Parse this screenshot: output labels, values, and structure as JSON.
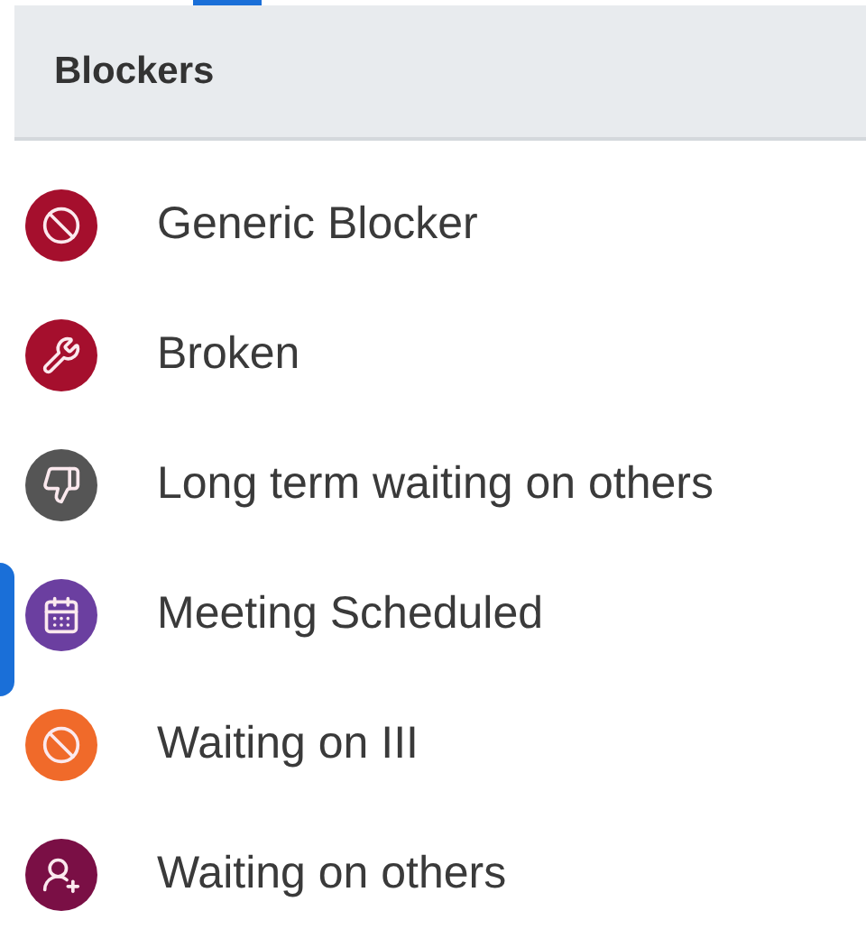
{
  "header": {
    "title": "Blockers"
  },
  "items": [
    {
      "label": "Generic Blocker",
      "kind": "blocked",
      "color": "#a50f2d"
    },
    {
      "label": "Broken",
      "kind": "broken",
      "color": "#a50f2d"
    },
    {
      "label": "Long term waiting on others",
      "kind": "disliked",
      "color": "#555555"
    },
    {
      "label": "Meeting Scheduled",
      "kind": "meeting",
      "color": "#6b3fa0"
    },
    {
      "label": "Waiting on III",
      "kind": "blocked",
      "color": "#f06a2a"
    },
    {
      "label": "Waiting on others",
      "kind": "handoff",
      "color": "#7a0f45"
    }
  ]
}
